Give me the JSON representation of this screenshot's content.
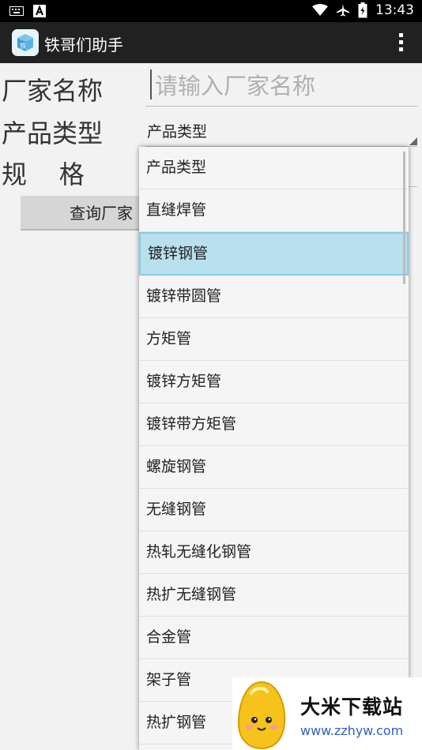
{
  "status_bar": {
    "time": "13:43",
    "left_icons": [
      "keyboard-icon",
      "a-notification-icon"
    ],
    "right_icons": [
      "wifi-icon",
      "airplane-icon",
      "battery-icon"
    ]
  },
  "action_bar": {
    "title": "铁哥们助手",
    "icon": "app-icon",
    "menu_icon": "overflow-menu-icon"
  },
  "form": {
    "manufacturer_label": "厂家名称",
    "manufacturer_placeholder": "请输入厂家名称",
    "manufacturer_value": "",
    "product_type_label": "产品类型",
    "product_type_value": "产品类型",
    "spec_label": "规    格",
    "query_button": "查询厂家"
  },
  "dropdown": {
    "selected_index": 2,
    "items": [
      "产品类型",
      "直缝焊管",
      "镀锌钢管",
      "镀锌带圆管",
      "方矩管",
      "镀锌方矩管",
      "镀锌带方矩管",
      "螺旋钢管",
      "无缝钢管",
      "热轧无缝化钢管",
      "热扩无缝钢管",
      "合金管",
      "架子管",
      "热扩钢管"
    ]
  },
  "watermark": {
    "title": "大米下载站",
    "url": "www.zzhyw.com"
  },
  "colors": {
    "action_bar": "#212121",
    "selected_item": "#b8e0ee",
    "watermark_url": "#2f5fc4"
  }
}
